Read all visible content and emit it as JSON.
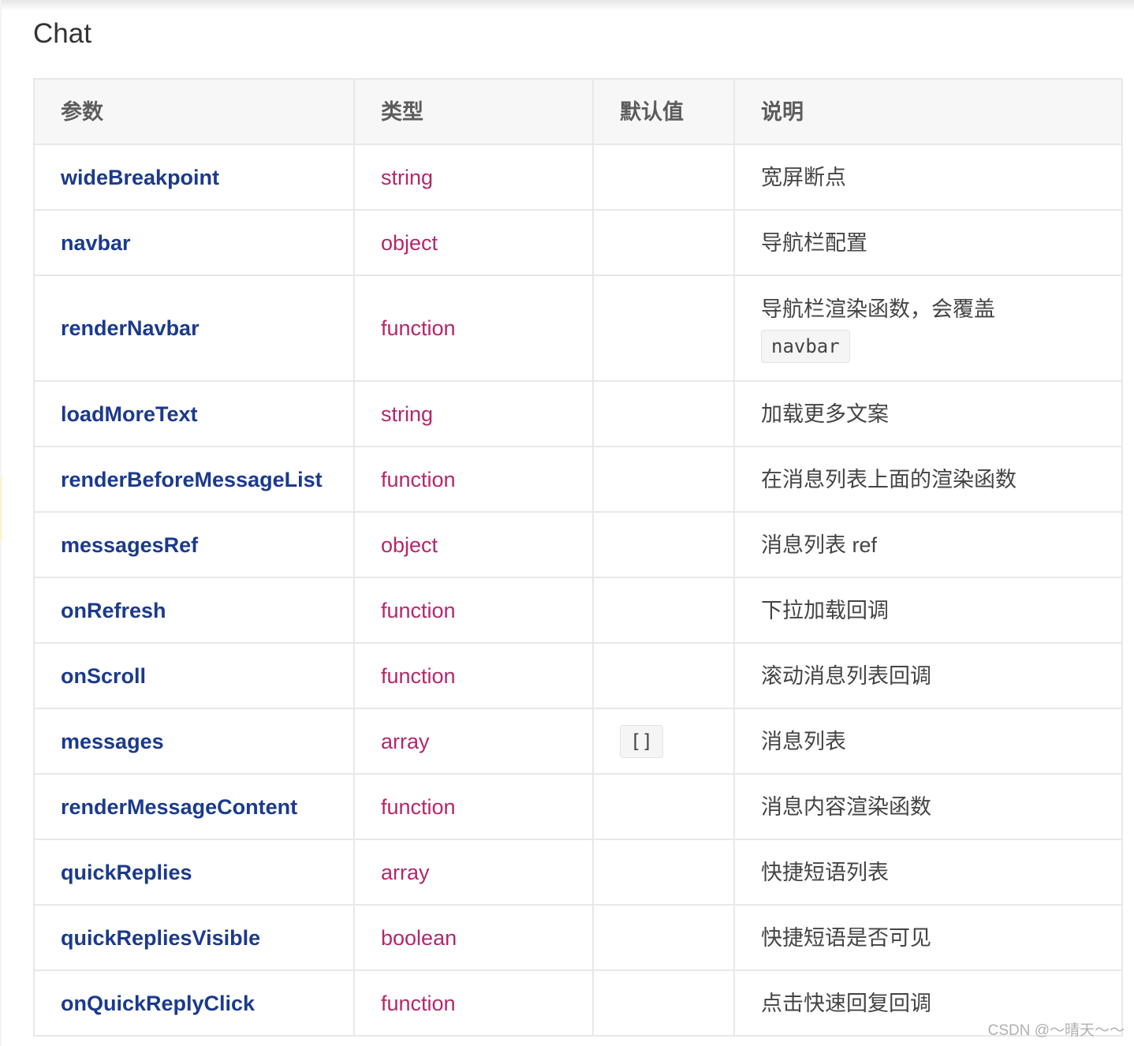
{
  "page": {
    "title": "Chat"
  },
  "table": {
    "headers": [
      "参数",
      "类型",
      "默认值",
      "说明"
    ],
    "rows": [
      {
        "name": "wideBreakpoint",
        "type": "string",
        "default": "",
        "desc": "宽屏断点"
      },
      {
        "name": "navbar",
        "type": "object",
        "default": "",
        "desc": "导航栏配置"
      },
      {
        "name": "renderNavbar",
        "type": "function",
        "default": "",
        "desc": "导航栏渲染函数，会覆盖",
        "desc_code": "navbar"
      },
      {
        "name": "loadMoreText",
        "type": "string",
        "default": "",
        "desc": "加载更多文案"
      },
      {
        "name": "renderBeforeMessageList",
        "type": "function",
        "default": "",
        "desc": "在消息列表上面的渲染函数"
      },
      {
        "name": "messagesRef",
        "type": "object",
        "default": "",
        "desc": "消息列表 ref"
      },
      {
        "name": "onRefresh",
        "type": "function",
        "default": "",
        "desc": "下拉加载回调"
      },
      {
        "name": "onScroll",
        "type": "function",
        "default": "",
        "desc": "滚动消息列表回调"
      },
      {
        "name": "messages",
        "type": "array",
        "default": "[]",
        "desc": "消息列表"
      },
      {
        "name": "renderMessageContent",
        "type": "function",
        "default": "",
        "desc": "消息内容渲染函数"
      },
      {
        "name": "quickReplies",
        "type": "array",
        "default": "",
        "desc": "快捷短语列表"
      },
      {
        "name": "quickRepliesVisible",
        "type": "boolean",
        "default": "",
        "desc": "快捷短语是否可见"
      },
      {
        "name": "onQuickReplyClick",
        "type": "function",
        "default": "",
        "desc": "点击快速回复回调"
      }
    ]
  },
  "watermark": "CSDN @～晴天～～",
  "colors": {
    "param_name": "#1b3a8c",
    "type_text": "#b4276b",
    "header_bg": "#f7f7f7",
    "border": "#e8e8e8"
  }
}
